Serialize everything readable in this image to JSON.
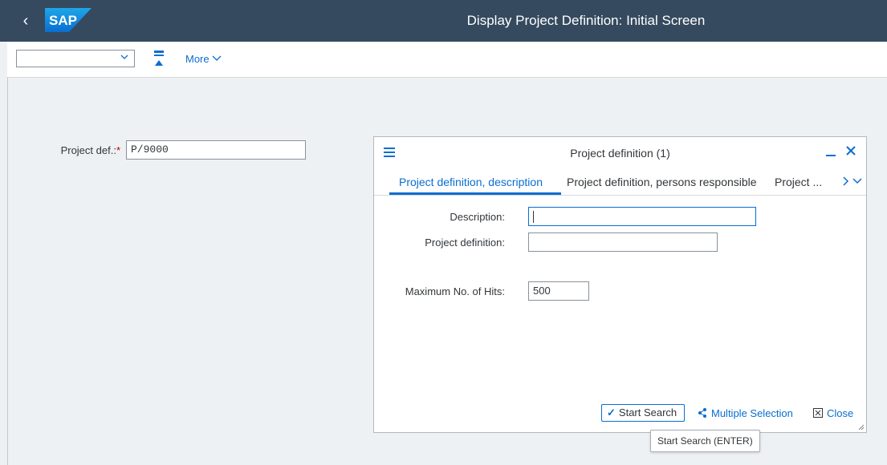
{
  "shell": {
    "title": "Display Project Definition: Initial Screen",
    "logo_text": "SAP",
    "back_icon": "‹"
  },
  "toolbar": {
    "command_value": "",
    "more_label": "More"
  },
  "form": {
    "project_def_label": "Project def.:",
    "required_marker": "*",
    "project_def_value": "P/9000"
  },
  "dialog": {
    "title": "Project definition (1)",
    "tabs": [
      {
        "label": "Project definition, description",
        "active": true
      },
      {
        "label": "Project definition, persons responsible",
        "active": false
      },
      {
        "label": "Project ...",
        "active": false
      }
    ],
    "fields": {
      "description_label": "Description:",
      "description_value": "",
      "project_definition_label": "Project definition:",
      "project_definition_value": "",
      "max_hits_label": "Maximum No. of Hits:",
      "max_hits_value": "500"
    },
    "buttons": {
      "start_search": "Start Search",
      "multiple_selection": "Multiple Selection",
      "close": "Close"
    }
  },
  "tooltip": {
    "text": "Start Search  (ENTER)"
  },
  "colors": {
    "shell_bg": "#354a5f",
    "accent": "#0a6ed1",
    "required": "#bb0000"
  }
}
